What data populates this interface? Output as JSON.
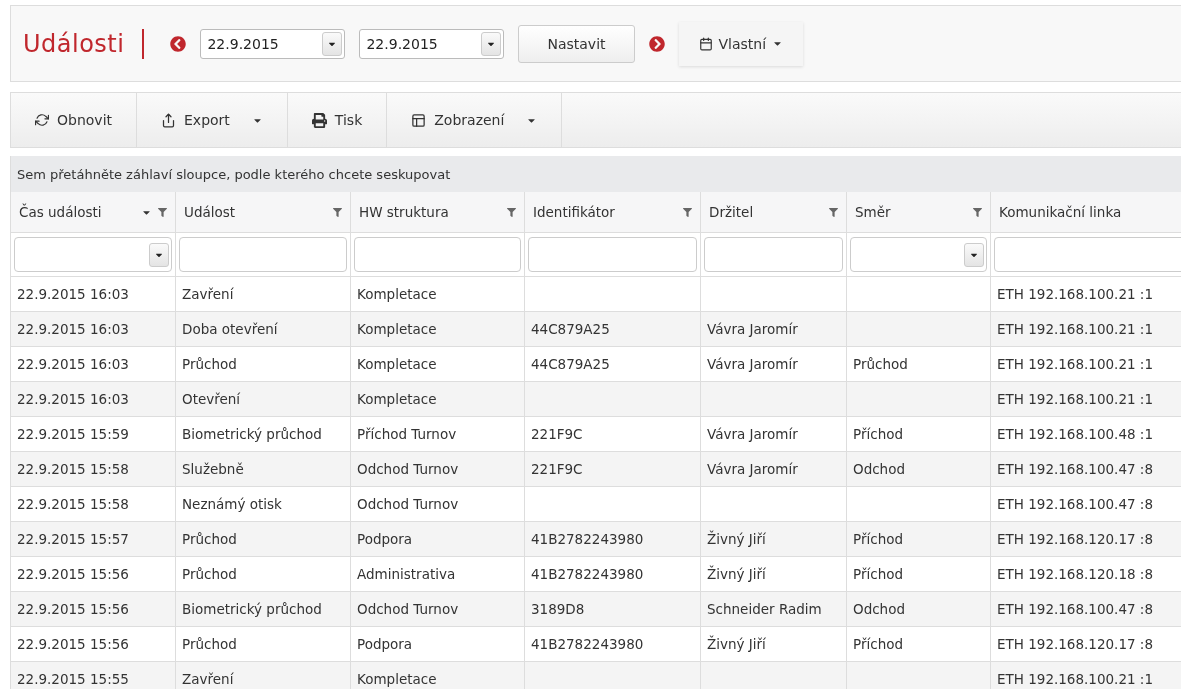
{
  "header": {
    "title": "Události",
    "date_from": "22.9.2015",
    "date_to": "22.9.2015",
    "set_button": "Nastavit",
    "range_menu": "Vlastní"
  },
  "toolbar": [
    {
      "label": "Obnovit",
      "kind": "refresh",
      "dropdown": false
    },
    {
      "label": "Export",
      "kind": "export",
      "dropdown": true
    },
    {
      "label": "Tisk",
      "kind": "print",
      "dropdown": false
    },
    {
      "label": "Zobrazení",
      "kind": "view",
      "dropdown": true
    }
  ],
  "group_hint": "Sem přetáhněte záhlaví sloupce, podle kterého chcete seskupovat",
  "table": {
    "columns": [
      {
        "label": "Čas události",
        "sorted": true,
        "filter_icon": true,
        "kind": "select"
      },
      {
        "label": "Událost",
        "sorted": false,
        "filter_icon": true,
        "kind": "text"
      },
      {
        "label": "HW struktura",
        "sorted": false,
        "filter_icon": true,
        "kind": "text"
      },
      {
        "label": "Identifikátor",
        "sorted": false,
        "filter_icon": true,
        "kind": "text"
      },
      {
        "label": "Držitel",
        "sorted": false,
        "filter_icon": true,
        "kind": "text"
      },
      {
        "label": "Směr",
        "sorted": false,
        "filter_icon": true,
        "kind": "select"
      },
      {
        "label": "Komunikační linka",
        "sorted": false,
        "filter_icon": false,
        "kind": "text"
      }
    ],
    "rows": [
      [
        "22.9.2015 16:03",
        "Zavření",
        "Kompletace",
        "",
        "",
        "",
        "ETH 192.168.100.21 :1"
      ],
      [
        "22.9.2015 16:03",
        "Doba otevření",
        "Kompletace",
        "44C879A25",
        "Vávra Jaromír",
        "",
        "ETH 192.168.100.21 :1"
      ],
      [
        "22.9.2015 16:03",
        "Průchod",
        "Kompletace",
        "44C879A25",
        "Vávra Jaromír",
        "Průchod",
        "ETH 192.168.100.21 :1"
      ],
      [
        "22.9.2015 16:03",
        "Otevření",
        "Kompletace",
        "",
        "",
        "",
        "ETH 192.168.100.21 :1"
      ],
      [
        "22.9.2015 15:59",
        "Biometrický průchod",
        "Příchod Turnov",
        "221F9C",
        "Vávra Jaromír",
        "Příchod",
        "ETH 192.168.100.48 :1"
      ],
      [
        "22.9.2015 15:58",
        "Služebně",
        "Odchod Turnov",
        "221F9C",
        "Vávra Jaromír",
        "Odchod",
        "ETH 192.168.100.47 :8"
      ],
      [
        "22.9.2015 15:58",
        "Neznámý otisk",
        "Odchod Turnov",
        "",
        "",
        "",
        "ETH 192.168.100.47 :8"
      ],
      [
        "22.9.2015 15:57",
        "Průchod",
        "Podpora",
        "41B2782243980",
        "Živný Jiří",
        "Příchod",
        "ETH 192.168.120.17 :8"
      ],
      [
        "22.9.2015 15:56",
        "Průchod",
        "Administrativa",
        "41B2782243980",
        "Živný Jiří",
        "Příchod",
        "ETH 192.168.120.18 :8"
      ],
      [
        "22.9.2015 15:56",
        "Biometrický průchod",
        "Odchod Turnov",
        "3189D8",
        "Schneider Radim",
        "Odchod",
        "ETH 192.168.100.47 :8"
      ],
      [
        "22.9.2015 15:56",
        "Průchod",
        "Podpora",
        "41B2782243980",
        "Živný Jiří",
        "Příchod",
        "ETH 192.168.120.17 :8"
      ],
      [
        "22.9.2015 15:55",
        "Zavření",
        "Kompletace",
        "",
        "",
        "",
        "ETH 192.168.100.21 :1"
      ]
    ]
  }
}
